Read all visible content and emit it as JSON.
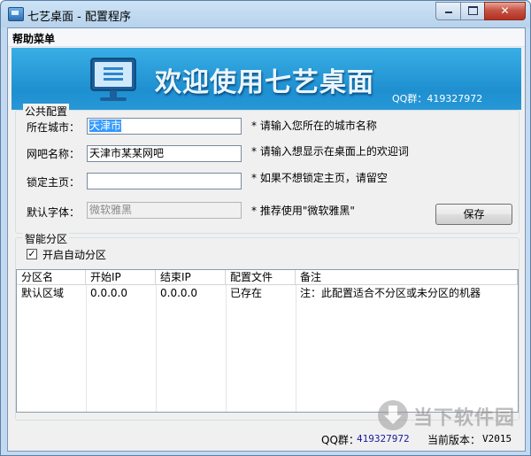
{
  "window": {
    "title": "七艺桌面 - 配置程序",
    "close_glyph": "✕"
  },
  "menubar": {
    "help_menu": "帮助菜单"
  },
  "banner": {
    "title": "欢迎使用七艺桌面",
    "qq_text": "QQ群：419327972",
    "icon": "monitor-icon"
  },
  "public_config": {
    "legend": "公共配置",
    "city_label": "所在城市：",
    "city_value": "天津市",
    "city_hint": "* 请输入您所在的城市名称",
    "netbar_label": "网吧名称：",
    "netbar_value": "天津市某某网吧",
    "netbar_hint": "* 请输入想显示在桌面上的欢迎词",
    "homepage_label": "锁定主页：",
    "homepage_value": "",
    "homepage_hint": "* 如果不想锁定主页，请留空",
    "font_label": "默认字体：",
    "font_value": "微软雅黑",
    "font_hint": "* 推荐使用\"微软雅黑\"",
    "save_button": "保存"
  },
  "smart_partition": {
    "legend": "智能分区",
    "auto_checkbox_label": "开启自动分区",
    "auto_checked": true,
    "check_glyph": "✓",
    "columns": [
      "分区名",
      "开始IP",
      "结束IP",
      "配置文件",
      "备注"
    ],
    "rows": [
      [
        "默认区域",
        "0.0.0.0",
        "0.0.0.0",
        "已存在",
        "注：此配置适合不分区或未分区的机器"
      ]
    ]
  },
  "watermark": {
    "text": "当下软件园"
  },
  "statusbar": {
    "qq_label": "QQ群：",
    "qq_value": "419327972",
    "version_label": "当前版本：",
    "version_value": "V2015"
  }
}
